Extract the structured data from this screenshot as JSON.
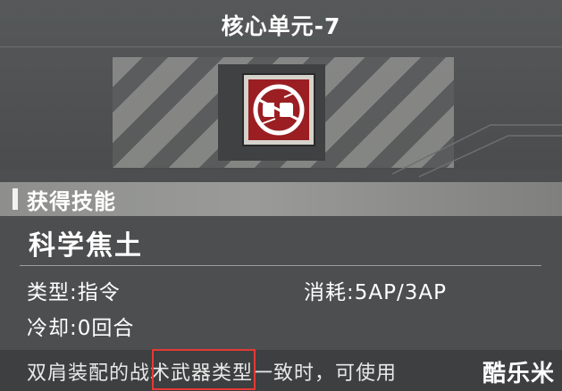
{
  "header": {
    "title": "核心单元-7",
    "skill_icon": "core-unit-skill-icon"
  },
  "section": {
    "title": "获得技能"
  },
  "skill": {
    "name": "科学焦土",
    "type": "类型:指令",
    "cost": "消耗:5AP/3AP",
    "cooldown": "冷却:0回合"
  },
  "description": {
    "text": "双肩装配的战术武器类型一致时，可使用"
  },
  "watermark": {
    "text": "酷乐米"
  },
  "colors": {
    "icon_red": "#9a1e22",
    "highlight": "#e53935"
  }
}
